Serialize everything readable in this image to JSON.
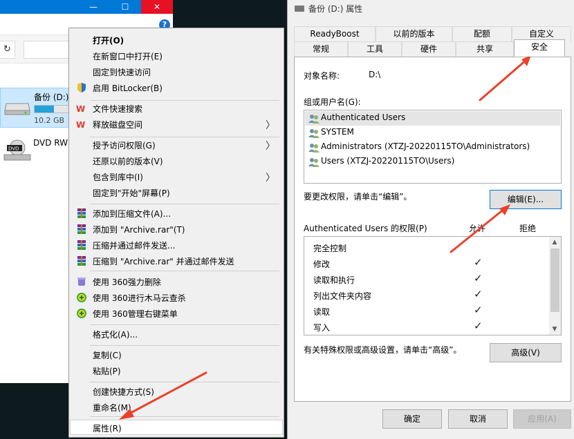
{
  "explorer": {
    "titlebar": {
      "minimize_icon": "minimize-icon",
      "maximize_icon": "maximize-icon",
      "close_icon": "close-icon",
      "minimize_glyph": "—",
      "maximize_glyph": "☐",
      "close_glyph": "✕"
    },
    "help_glyph": "?",
    "refresh_glyph": "↻",
    "drives": [
      {
        "name": "备份 (D:)",
        "size": "10.2 GB",
        "used_fraction": 0.52
      },
      {
        "name": "DVD RW",
        "icon": "dvd-drive-icon"
      }
    ]
  },
  "context_menu": {
    "items": [
      {
        "label": "打开(O)",
        "bold": true
      },
      {
        "label": "在新窗口中打开(E)"
      },
      {
        "label": "固定到快速访问"
      },
      {
        "label": "启用 BitLocker(B)",
        "icon": "shield-icon"
      },
      {
        "label": "文件快速搜索",
        "icon": "wps-icon"
      },
      {
        "label": "释放磁盘空间",
        "icon": "wps-icon",
        "submenu": true
      },
      {
        "label": "授予访问权限(G)",
        "submenu": true
      },
      {
        "label": "还原以前的版本(V)"
      },
      {
        "label": "包含到库中(I)",
        "submenu": true
      },
      {
        "label": "固定到\"开始\"屏幕(P)"
      },
      {
        "label": "添加到压缩文件(A)...",
        "icon": "winrar-icon"
      },
      {
        "label": "添加到 \"Archive.rar\"(T)",
        "icon": "winrar-icon"
      },
      {
        "label": "压缩并通过邮件发送...",
        "icon": "winrar-icon"
      },
      {
        "label": "压缩到 \"Archive.rar\" 并通过邮件发送",
        "icon": "winrar-icon"
      },
      {
        "label": "使用 360强力删除",
        "icon": "360-delete-icon"
      },
      {
        "label": "使用 360进行木马云查杀",
        "icon": "360-scan-icon"
      },
      {
        "label": "使用 360管理右键菜单",
        "icon": "360-scan-icon"
      },
      {
        "label": "格式化(A)..."
      },
      {
        "label": "复制(C)"
      },
      {
        "label": "粘贴(P)"
      },
      {
        "label": "创建快捷方式(S)"
      },
      {
        "label": "重命名(M)"
      },
      {
        "label": "属性(R)",
        "highlighted": true
      }
    ],
    "submenu_glyph": "〉"
  },
  "properties": {
    "title": "备份 (D:) 属性",
    "tabs_row1": [
      "ReadyBoost",
      "以前的版本",
      "配额",
      "自定义"
    ],
    "tabs_row2": [
      "常规",
      "工具",
      "硬件",
      "共享",
      "安全"
    ],
    "active_tab": "安全",
    "object_name_label": "对象名称:",
    "object_name_value": "D:\\",
    "groups_label": "组或用户名(G):",
    "groups": [
      "Authenticated Users",
      "SYSTEM",
      "Administrators (XTZJ-20220115TO\\Administrators)",
      "Users (XTZJ-20220115TO\\Users)"
    ],
    "selected_group_index": 0,
    "change_hint": "要更改权限，请单击“编辑”。",
    "edit_button": "编辑(E)...",
    "perm_header": "Authenticated Users 的权限(P)",
    "allow_header": "允许",
    "deny_header": "拒绝",
    "permissions": [
      {
        "name": "完全控制",
        "allow": "",
        "deny": ""
      },
      {
        "name": "修改",
        "allow": "✓",
        "deny": ""
      },
      {
        "name": "读取和执行",
        "allow": "✓",
        "deny": ""
      },
      {
        "name": "列出文件夹内容",
        "allow": "✓",
        "deny": ""
      },
      {
        "name": "读取",
        "allow": "✓",
        "deny": ""
      },
      {
        "name": "写入",
        "allow": "✓",
        "deny": ""
      }
    ],
    "scroll_up_glyph": "▲",
    "scroll_down_glyph": "▼",
    "advanced_hint": "有关特殊权限或高级设置，请单击“高级”。",
    "advanced_button": "高级(V)",
    "ok_button": "确定",
    "cancel_button": "取消",
    "apply_button": "应用(A)"
  },
  "colors": {
    "accent": "#0078d7",
    "annotation_arrow": "#e8412c",
    "selection": "#cce8ff"
  }
}
